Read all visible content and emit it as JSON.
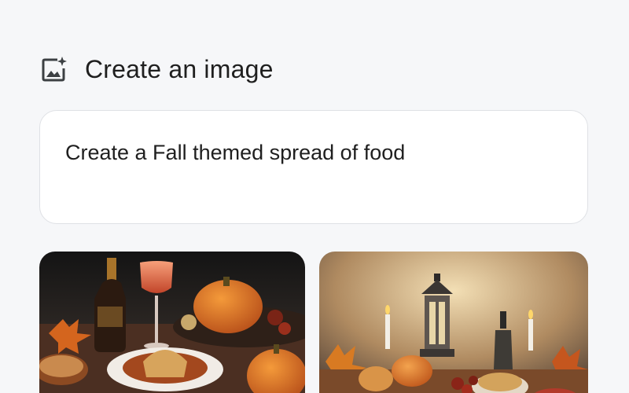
{
  "header": {
    "title": "Create an image",
    "icon": "image-sparkle-icon"
  },
  "prompt": {
    "text": "Create a Fall themed spread of food"
  },
  "results": [
    {
      "name": "generated-image-1",
      "theme": "wine-pumpkin-pasta-table"
    },
    {
      "name": "generated-image-2",
      "theme": "lantern-candles-harvest-table"
    }
  ],
  "colors": {
    "background": "#f6f7f9",
    "card": "#ffffff",
    "border": "#dfe1e5",
    "text": "#1f1f1f"
  }
}
